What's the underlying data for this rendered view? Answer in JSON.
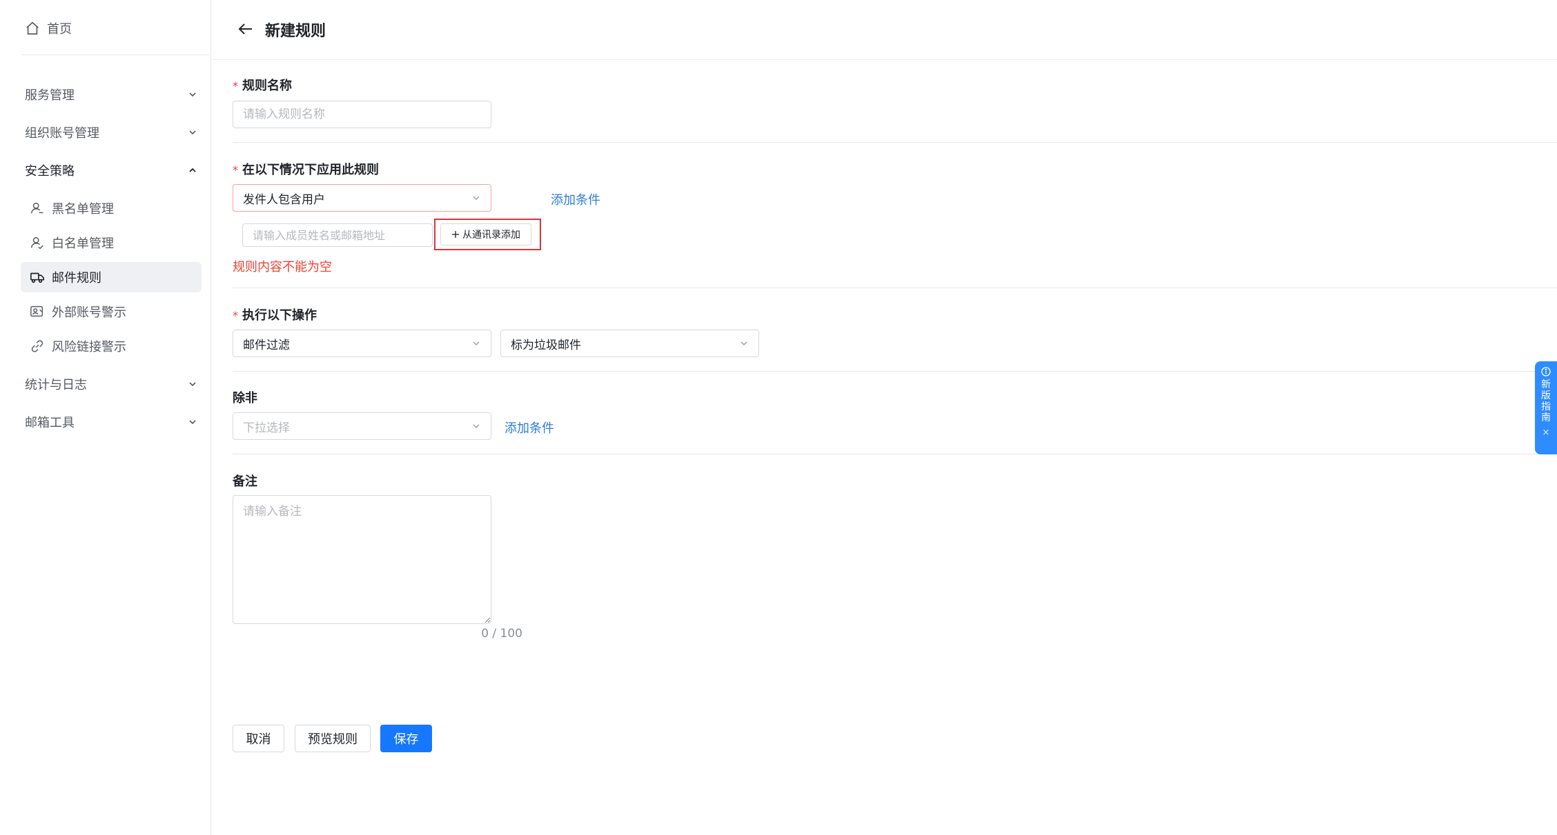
{
  "sidebar": {
    "home_label": "首页",
    "groups": {
      "service": "服务管理",
      "org": "组织账号管理",
      "security": "安全策略",
      "stats": "统计与日志",
      "tools": "邮箱工具"
    },
    "items": {
      "blacklist": "黑名单管理",
      "whitelist": "白名单管理",
      "mail_rules": "邮件规则",
      "external_warning": "外部账号警示",
      "risk_link": "风险链接警示"
    },
    "active_item": "邮件规则"
  },
  "header": {
    "title": "新建规则"
  },
  "form": {
    "required_mark": "*",
    "rule_name": {
      "label": "规则名称",
      "placeholder": "请输入规则名称",
      "value": ""
    },
    "conditions": {
      "label": "在以下情况下应用此规则",
      "condition_value": "发件人包含用户",
      "add_condition": "添加条件",
      "member_placeholder": "请输入成员姓名或邮箱地址",
      "add_from_contacts": "从通讯录添加",
      "error": "规则内容不能为空"
    },
    "actions": {
      "label": "执行以下操作",
      "action_value": "邮件过滤",
      "action_target": "标为垃圾邮件"
    },
    "except": {
      "label": "除非",
      "placeholder": "下拉选择",
      "add_condition": "添加条件"
    },
    "remark": {
      "label": "备注",
      "placeholder": "请输入备注",
      "counter": "0 / 100"
    }
  },
  "buttons": {
    "cancel": "取消",
    "preview": "预览规则",
    "save": "保存"
  },
  "guide": {
    "text": "新版指南",
    "close": "×"
  },
  "colors": {
    "primary": "#1677ff",
    "link": "#2f7bdc",
    "error": "#f04134",
    "guide": "#2f8cff"
  }
}
